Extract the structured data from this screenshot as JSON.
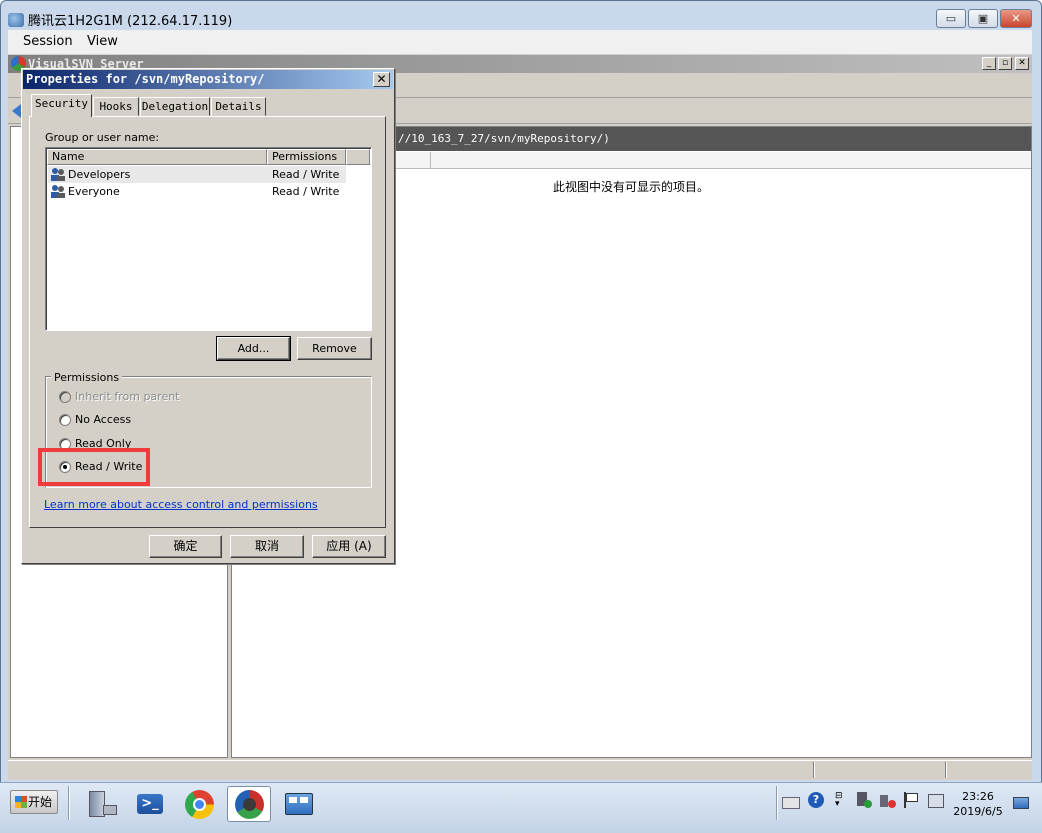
{
  "outer_window": {
    "title": "腾讯云1H2G1M (212.64.17.119)",
    "menu": [
      "Session",
      "View"
    ],
    "controls": {
      "minimize": "▭",
      "restore": "▣",
      "close": "✕"
    }
  },
  "app_window": {
    "title": "VisualSVN Server",
    "mdi_controls": {
      "minimize": "_",
      "restore": "▫",
      "close": "✕"
    },
    "path_text": "//10_163_7_27/svn/myRepository/)",
    "empty_message": "此视图中没有可显示的项目。"
  },
  "dialog": {
    "title": "Properties for /svn/myRepository/",
    "close_label": "✕",
    "tabs": [
      "Security",
      "Hooks",
      "Delegation",
      "Details"
    ],
    "active_tab": "Security",
    "group_label": "Group or user name:",
    "columns": [
      "Name",
      "Permissions"
    ],
    "rows": [
      {
        "name": "Developers",
        "permissions": "Read / Write",
        "selected": true
      },
      {
        "name": "Everyone",
        "permissions": "Read / Write",
        "selected": false
      }
    ],
    "add_button": "Add...",
    "remove_button": "Remove",
    "permissions_legend": "Permissions",
    "options": [
      {
        "label": "Inherit from parent",
        "enabled": false,
        "checked": false
      },
      {
        "label": "No Access",
        "enabled": true,
        "checked": false
      },
      {
        "label": "Read Only",
        "enabled": true,
        "checked": false
      },
      {
        "label": "Read / Write",
        "enabled": true,
        "checked": true
      }
    ],
    "learn_more": "Learn more about access control and permissions",
    "ok_button": "确定",
    "cancel_button": "取消",
    "apply_button": "应用 (A)",
    "highlight_color": "#ee3b3b"
  },
  "taskbar": {
    "start_label": "开始",
    "apps": [
      "server-manager-icon",
      "powershell-icon",
      "chrome-icon",
      "visualsvn-icon",
      "control-panel-icon"
    ],
    "clock_time": "23:26",
    "clock_date": "2019/6/5"
  }
}
